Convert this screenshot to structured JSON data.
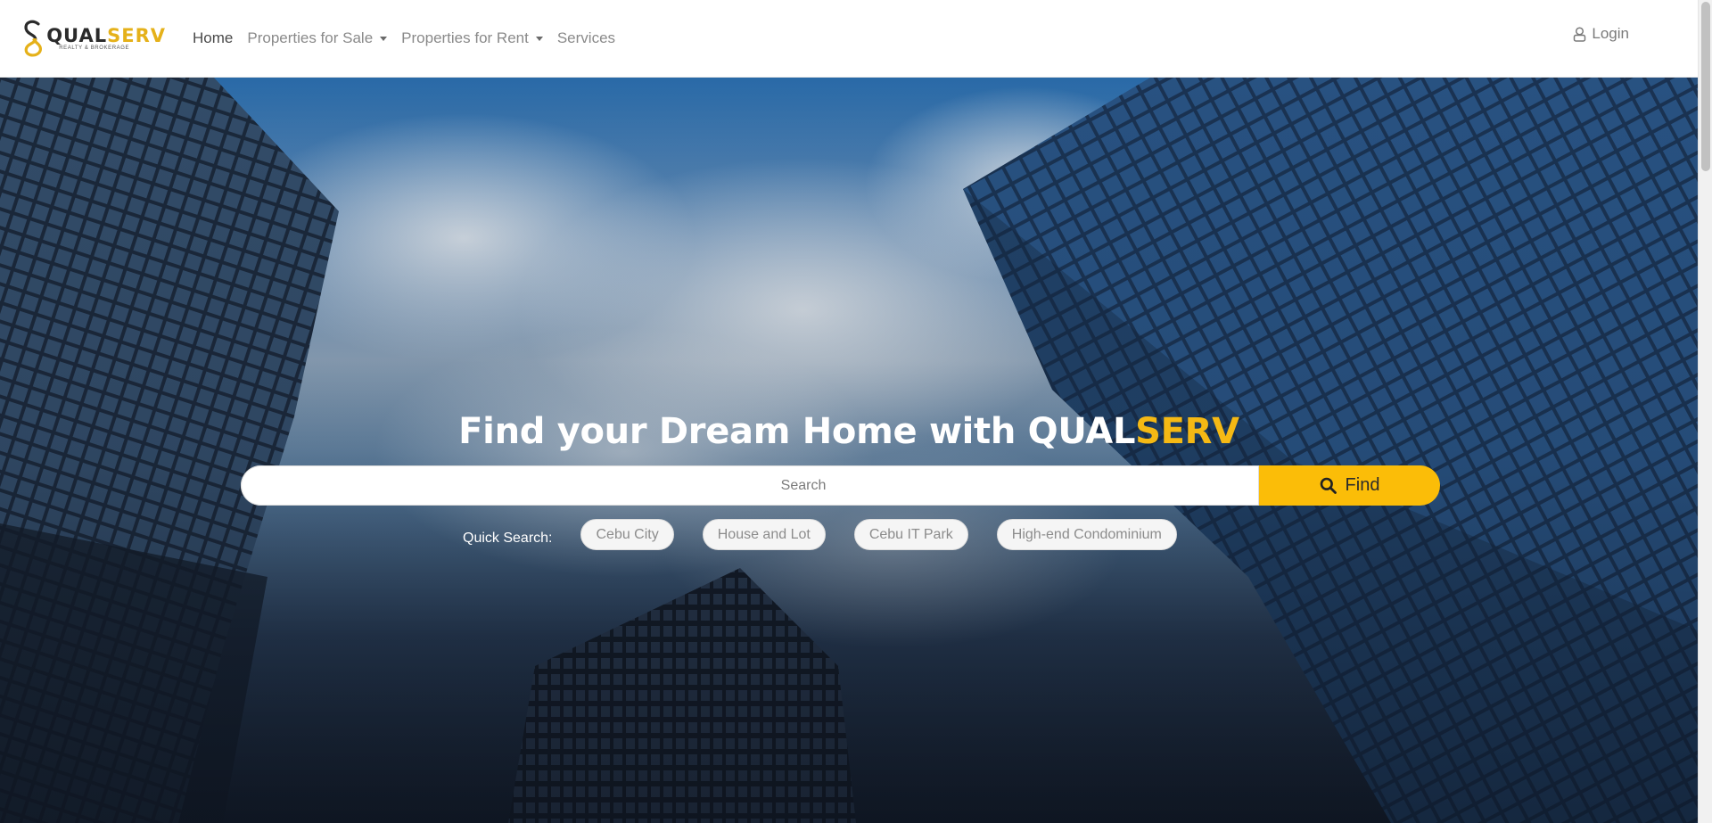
{
  "brand": {
    "name_part1": "QUAL",
    "name_part2": "SERV",
    "tagline": "REALTY & BROKERAGE"
  },
  "nav": {
    "items": [
      {
        "label": "Home",
        "active": true,
        "dropdown": false
      },
      {
        "label": "Properties for Sale",
        "active": false,
        "dropdown": true
      },
      {
        "label": "Properties for Rent",
        "active": false,
        "dropdown": true
      },
      {
        "label": "Services",
        "active": false,
        "dropdown": false
      }
    ],
    "login_label": "Login"
  },
  "hero": {
    "title_prefix": "Find your Dream Home with ",
    "title_brand_1": "QUAL",
    "title_brand_2": "SERV",
    "search": {
      "placeholder": "Search",
      "value": "",
      "button_label": "Find"
    },
    "quick_search": {
      "label": "Quick Search:",
      "chips": [
        "Cebu City",
        "House and Lot",
        "Cebu IT Park",
        "High-end Condominium"
      ]
    }
  },
  "colors": {
    "accent": "#fbbd08",
    "brand_gold": "#e5b11a",
    "nav_text": "#8a8a8a"
  },
  "icons": {
    "login": "user-icon",
    "find": "search-icon",
    "caret": "caret-down-icon"
  }
}
